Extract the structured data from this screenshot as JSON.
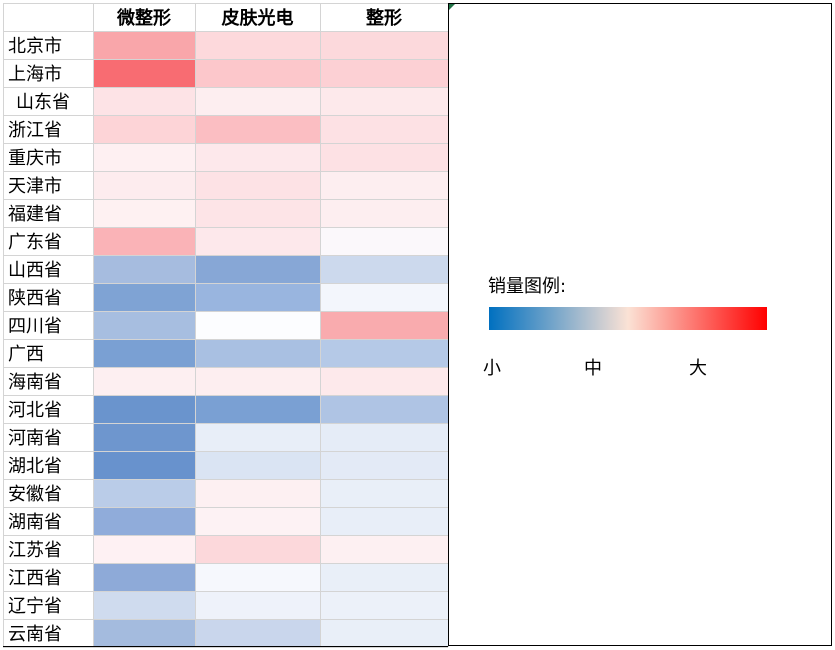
{
  "chart_data": {
    "type": "heatmap",
    "columns": [
      "微整形",
      "皮肤光电",
      "整形"
    ],
    "rows": [
      "北京市",
      "上海市",
      "山东省",
      "浙江省",
      "重庆市",
      "天津市",
      "福建省",
      "广东省",
      "山西省",
      "陕西省",
      "四川省",
      "广西",
      "海南省",
      "河北省",
      "河南省",
      "湖北省",
      "安徽省",
      "湖南省",
      "江苏省",
      "江西省",
      "辽宁省",
      "云南省"
    ],
    "cell_colors": [
      [
        "#f9a6aa",
        "#fdd9dc",
        "#fcd9dc"
      ],
      [
        "#f86c72",
        "#fcc7cb",
        "#fcd0d4"
      ],
      [
        "#fde3e6",
        "#fdeef0",
        "#fde9eb"
      ],
      [
        "#fdd4d7",
        "#fbbec2",
        "#fde1e4"
      ],
      [
        "#fef0f2",
        "#fde8eb",
        "#fde1e4"
      ],
      [
        "#fdecee",
        "#fde2e5",
        "#fdeef0"
      ],
      [
        "#fef1f2",
        "#fde4e7",
        "#fdeef0"
      ],
      [
        "#fab3b7",
        "#fde8eb",
        "#fbf8fb"
      ],
      [
        "#a6bcdf",
        "#87a7d6",
        "#ccd9ed"
      ],
      [
        "#7fa3d4",
        "#99b5df",
        "#f3f6fc"
      ],
      [
        "#a7bee0",
        "#fcfdff",
        "#f9abae"
      ],
      [
        "#7aa0d3",
        "#a9c0e2",
        "#b5c9e7"
      ],
      [
        "#fdeff1",
        "#fdeef0",
        "#fde9eb"
      ],
      [
        "#6a94cd",
        "#7aa0d3",
        "#afc4e4"
      ],
      [
        "#6e96ce",
        "#e8eef8",
        "#e5ecf7"
      ],
      [
        "#6892cd",
        "#dae4f3",
        "#e3eaf6"
      ],
      [
        "#bacce8",
        "#fdf0f2",
        "#e9eff8"
      ],
      [
        "#90acda",
        "#fdf2f4",
        "#e8eef8"
      ],
      [
        "#fef1f3",
        "#fcd8db",
        "#fdf0f2"
      ],
      [
        "#8eaad8",
        "#f6f8fd",
        "#e9eff8"
      ],
      [
        "#cfdbee",
        "#eef2fa",
        "#ecf1f9"
      ],
      [
        "#a4bbde",
        "#c9d6ec",
        "#e9eff8"
      ]
    ]
  },
  "legend": {
    "title": "销量图例:",
    "gradient_colors": [
      "#0070c0",
      "#fbe2d5",
      "#ff0000"
    ],
    "labels": [
      "小",
      "中",
      "大"
    ]
  }
}
